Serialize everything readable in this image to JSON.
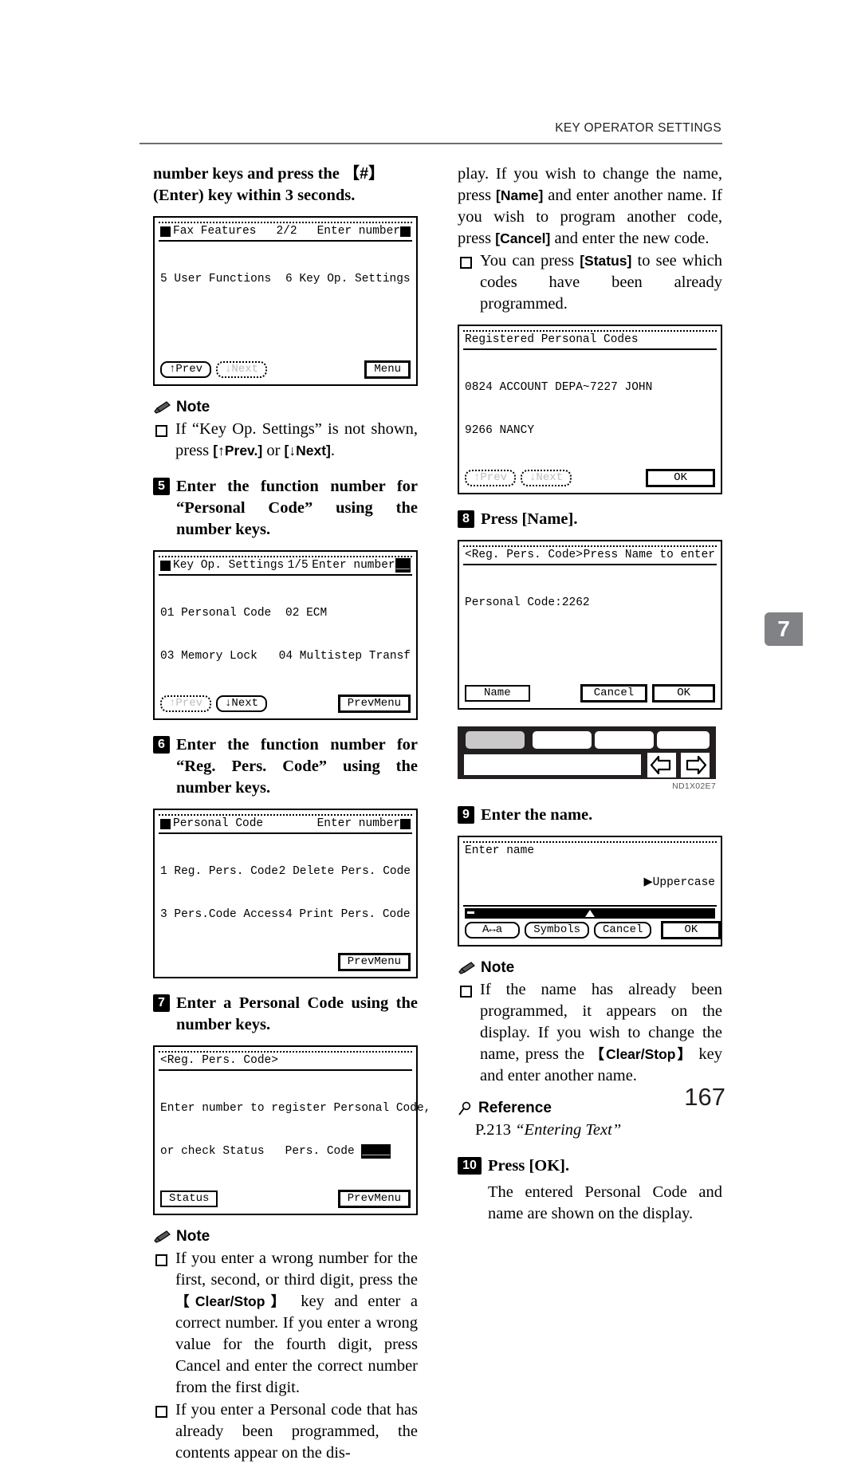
{
  "header": {
    "title": "KEY OPERATOR SETTINGS"
  },
  "chapter_tab": {
    "number": "7"
  },
  "page_number": "167",
  "left_column": {
    "continued_heading_line1": "number  keys  and  press  the",
    "continued_heading_key": "【#】",
    "continued_heading_line2": "(Enter) key within 3 seconds.",
    "lcd_fax_features": {
      "title_left": "Fax Features",
      "title_center": "2/2",
      "title_right": "Enter number",
      "row1_left": "5 User Functions",
      "row1_right": "6 Key Op. Settings",
      "btn_prev": "↑Prev",
      "btn_next": "↓Next",
      "btn_menu": "Menu"
    },
    "note1_label": "Note",
    "note1_item1_a": "If “Key Op. Settings” is not shown, press",
    "note1_item1_key1": "[↑Prev.]",
    "note1_item1_b": "or",
    "note1_item1_key2": "[↓Next]",
    "note1_item1_c": ".",
    "step5": {
      "number": "5",
      "text": "Enter the function number for “Personal Code” using the number keys."
    },
    "lcd_key_op_settings": {
      "title_left": "Key Op. Settings",
      "title_center": "1/5",
      "title_right": "Enter number",
      "row1_left": "01 Personal Code",
      "row1_right": "02 ECM",
      "row2_left": "03 Memory Lock",
      "row2_right": "04 Multistep Transf",
      "btn_prev": "↑Prev",
      "btn_next": "↓Next",
      "btn_prevmenu": "PrevMenu"
    },
    "step6": {
      "number": "6",
      "text": "Enter the function number for “Reg. Pers. Code” using the number keys."
    },
    "lcd_personal_code": {
      "title_left": "Personal Code",
      "title_right": "Enter number",
      "row1_left": "1 Reg. Pers. Code",
      "row1_right": "2 Delete Pers. Code",
      "row2_left": "3 Pers.Code Access",
      "row2_right": "4 Print Pers. Code",
      "btn_prevmenu": "PrevMenu"
    },
    "step7": {
      "number": "7",
      "text": "Enter a Personal Code using the number keys."
    },
    "lcd_reg_pers_code": {
      "title_left": "<Reg. Pers. Code>",
      "row1": "Enter number to register Personal Code,",
      "row2_a": "or check Status",
      "row2_b": "Pers. Code",
      "row2_field": "____",
      "btn_status": "Status",
      "btn_prevmenu": "PrevMenu"
    },
    "note2_label": "Note",
    "note2_item1_a": "If you enter a wrong number for the first, second, or third digit, press the",
    "note2_item1_key": "【Clear/Stop】",
    "note2_item1_b": "key and enter a correct number. If you enter a wrong value for the fourth digit, press Cancel and enter the correct number from the first digit.",
    "note2_item2": "If you enter a Personal code that has already been programmed, the contents appear on the dis-"
  },
  "right_column": {
    "continued_para_a": "play. If you wish to change the name, press",
    "continued_para_key1": "[Name]",
    "continued_para_b": "and enter another name. If you wish to program another code, press",
    "continued_para_key2": "[Cancel]",
    "continued_para_c": "and enter the new code.",
    "note_item_status_a": "You can press",
    "note_item_status_key": "[Status]",
    "note_item_status_b": "to see which codes have been already programmed.",
    "lcd_registered_codes": {
      "title": "Registered Personal Codes",
      "row1_left": "0824 ACCOUNT DEPA~",
      "row1_right": "7227 JOHN",
      "row2_left": "9266 NANCY",
      "btn_prev": "↑Prev",
      "btn_next": "↓Next",
      "btn_ok": "OK"
    },
    "step8": {
      "number": "8",
      "text_a": "Press",
      "key": "[Name]",
      "text_b": "."
    },
    "lcd_press_name": {
      "title_left": "<Reg. Pers. Code>",
      "title_right": "Press Name to enter",
      "row1": "Personal Code:2262",
      "btn_name": "Name",
      "btn_cancel": "Cancel",
      "btn_ok": "OK"
    },
    "panel_illustration": {
      "caption": "ND1X02E7"
    },
    "step9": {
      "number": "9",
      "text": "Enter the name."
    },
    "lcd_enter_name": {
      "title": "Enter name",
      "mode_label": "▶Uppercase",
      "btn_case": "A↔a",
      "btn_symbols": "Symbols",
      "btn_cancel": "Cancel",
      "btn_ok": "OK"
    },
    "note3_label": "Note",
    "note3_item1_a": "If the name has already been programmed, it appears on the display. If you wish to change the name, press the",
    "note3_item1_key": "【Clear/Stop】",
    "note3_item1_b": "key and enter another name.",
    "reference_label": "Reference",
    "reference_page": "P.213",
    "reference_title": "“Entering Text”",
    "step10": {
      "number": "10",
      "text_a": "Press",
      "key": "[OK]",
      "text_b": ".",
      "follow_text": "The entered Personal Code and name are shown on the display."
    }
  }
}
